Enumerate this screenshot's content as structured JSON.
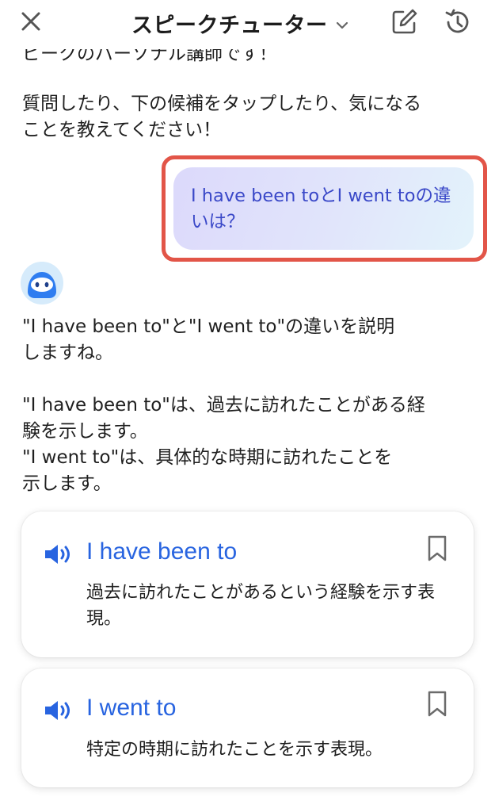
{
  "header": {
    "title": "スピークチューター",
    "icons": [
      "close-icon",
      "chevron-down-icon",
      "edit-icon",
      "history-icon"
    ]
  },
  "intro": {
    "line1": "ピークのパーソナル講師です！",
    "para2": "質問したり、下の候補をタップしたり、気になる\nことを教えてください！"
  },
  "user_message": {
    "text": "I have been toとI went toの違いは？"
  },
  "assistant": {
    "avatar": "tutor-avatar",
    "reply": "\"I have been to\"と\"I went to\"の違いを説明\nしますね。\n\n\"I have been to\"は、過去に訪れたことがある経\n験を示します。\n\"I went to\"は、具体的な時期に訪れたことを\n示します。"
  },
  "cards": [
    {
      "phrase": "I have been to",
      "meaning": "過去に訪れたことがあるという経験を示す表現。"
    },
    {
      "phrase": "I went to",
      "meaning": "特定の時期に訪れたことを示す表現。"
    }
  ],
  "colors": {
    "accent_blue": "#2864e0",
    "highlight_red": "#e25548",
    "bubble_text": "#3a48c8"
  }
}
